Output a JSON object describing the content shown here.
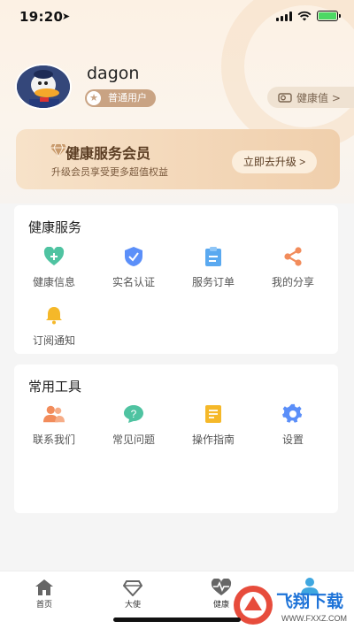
{
  "status_bar": {
    "time": "19:20",
    "location_icon": "location-arrow-icon"
  },
  "profile": {
    "username": "dagon",
    "badge": "普通用户",
    "health_value_label": "健康值 >"
  },
  "membership": {
    "title": "健康服务会员",
    "subtitle": "升级会员享受更多超值权益",
    "upgrade_label": "立即去升级 >"
  },
  "health_services": {
    "title": "健康服务",
    "items": [
      {
        "label": "健康信息",
        "icon": "heart-plus-icon",
        "color": "#4fc3a1"
      },
      {
        "label": "实名认证",
        "icon": "shield-check-icon",
        "color": "#5b8ff9"
      },
      {
        "label": "服务订单",
        "icon": "clipboard-icon",
        "color": "#5aa9f0"
      },
      {
        "label": "我的分享",
        "icon": "share-icon",
        "color": "#f28c5b"
      },
      {
        "label": "订阅通知",
        "icon": "bell-icon",
        "color": "#f5b829"
      }
    ]
  },
  "tools": {
    "title": "常用工具",
    "items": [
      {
        "label": "联系我们",
        "icon": "contacts-icon",
        "color": "#f28c5b"
      },
      {
        "label": "常见问题",
        "icon": "question-bubble-icon",
        "color": "#4fc3a1"
      },
      {
        "label": "操作指南",
        "icon": "guide-book-icon",
        "color": "#f5b829"
      },
      {
        "label": "设置",
        "icon": "gear-icon",
        "color": "#5b8ff9"
      }
    ]
  },
  "tabbar": {
    "items": [
      {
        "label": "首页",
        "icon": "home-icon"
      },
      {
        "label": "大使",
        "icon": "diamond-icon"
      },
      {
        "label": "健康",
        "icon": "heartbeat-icon"
      },
      {
        "label": "",
        "icon": "person-icon"
      }
    ]
  },
  "watermark": {
    "text": "飞翔下载",
    "url_text": "WWW.FXXZ.COM"
  },
  "colors": {
    "accent_gold": "#c9a383",
    "member_text": "#5a3c22",
    "background": "#f5f5f5"
  }
}
